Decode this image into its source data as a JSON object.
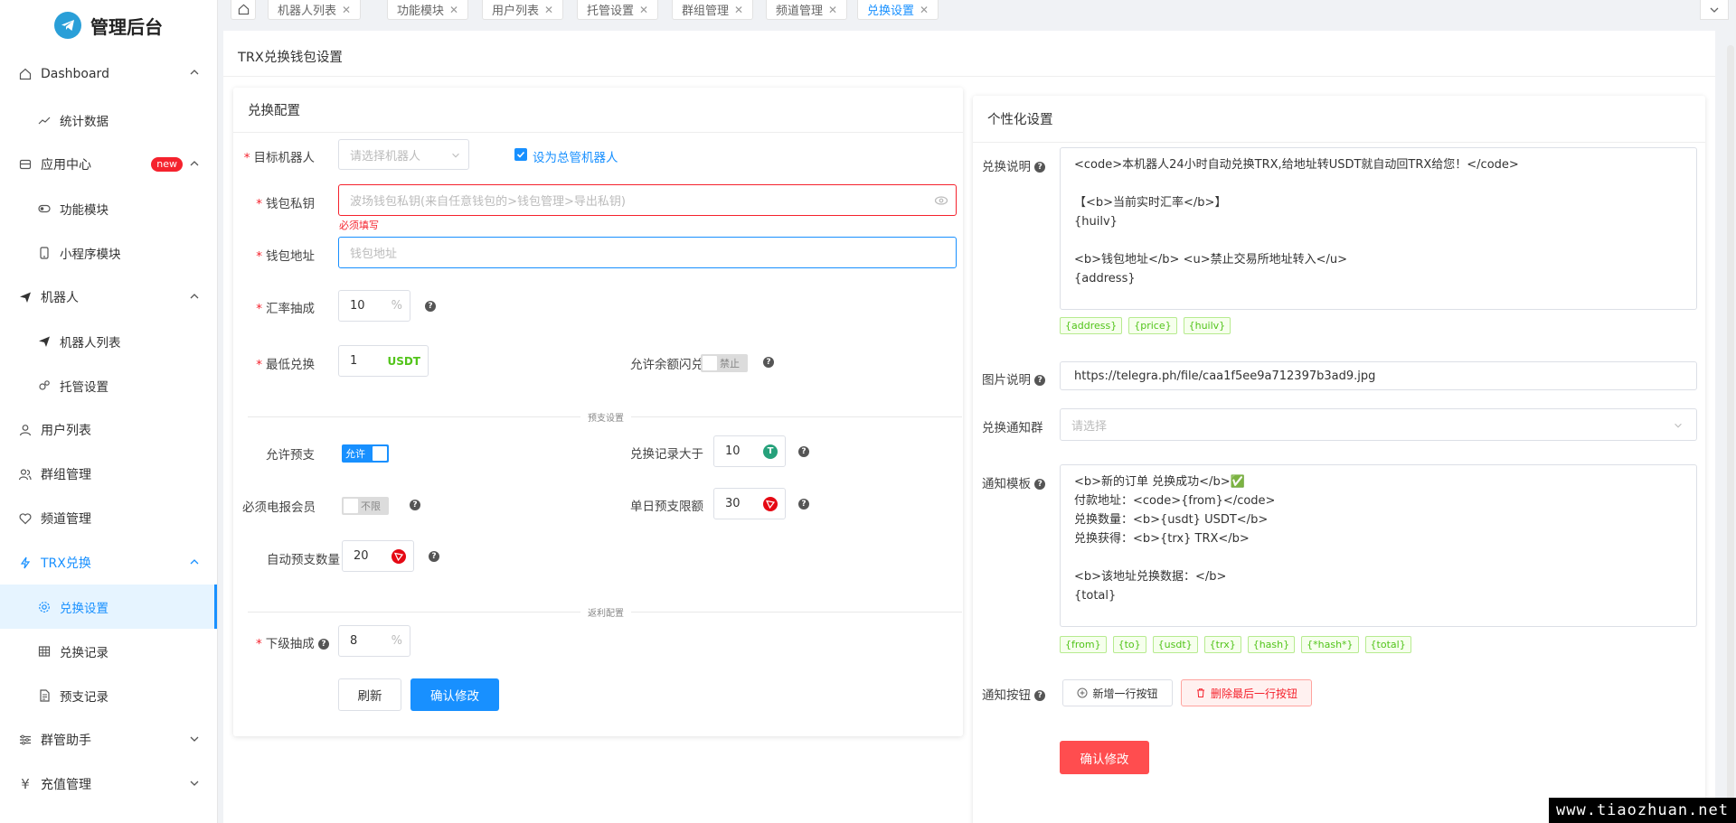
{
  "app": {
    "title": "管理后台"
  },
  "sidebar": {
    "items": [
      {
        "label": "Dashboard"
      },
      {
        "label": "统计数据"
      },
      {
        "label": "应用中心",
        "badge": "new"
      },
      {
        "label": "功能模块"
      },
      {
        "label": "小程序模块"
      },
      {
        "label": "机器人"
      },
      {
        "label": "机器人列表"
      },
      {
        "label": "托管设置"
      },
      {
        "label": "用户列表"
      },
      {
        "label": "群组管理"
      },
      {
        "label": "频道管理"
      },
      {
        "label": "TRX兑换"
      },
      {
        "label": "兑换设置"
      },
      {
        "label": "兑换记录"
      },
      {
        "label": "预支记录"
      },
      {
        "label": "群管助手"
      },
      {
        "label": "充值管理"
      }
    ]
  },
  "tabs": [
    {
      "label": "机器人列表"
    },
    {
      "label": "功能模块"
    },
    {
      "label": "用户列表"
    },
    {
      "label": "托管设置"
    },
    {
      "label": "群组管理"
    },
    {
      "label": "频道管理"
    },
    {
      "label": "兑换设置"
    }
  ],
  "page": {
    "title": "TRX兑换钱包设置"
  },
  "exchange": {
    "title": "兑换配置",
    "target_bot_label": "目标机器人",
    "target_bot_placeholder": "请选择机器人",
    "master_bot_label": "设为总管机器人",
    "private_key_label": "钱包私钥",
    "private_key_placeholder": "波场钱包私钥(来自任意钱包的>钱包管理>导出私钥)",
    "private_key_error": "必须填写",
    "address_label": "钱包地址",
    "address_placeholder": "钱包地址",
    "rate_label": "汇率抽成",
    "rate_value": "10",
    "rate_suffix": "%",
    "min_label": "最低兑换",
    "min_value": "1",
    "min_suffix": "USDT",
    "flash_label": "允许余额闪兑",
    "flash_switch": "禁止",
    "advance_divider": "预支设置",
    "allow_advance_label": "允许预支",
    "allow_advance_switch": "允许",
    "records_gt_label": "兑换记录大于",
    "records_gt_value": "10",
    "premium_label": "必须电报会员",
    "premium_switch": "不限",
    "daily_limit_label": "单日预支限额",
    "daily_limit_value": "30",
    "auto_advance_label": "自动预支数量",
    "auto_advance_value": "20",
    "rebate_divider": "返利配置",
    "sub_rate_label": "下级抽成",
    "sub_rate_value": "8",
    "sub_rate_suffix": "%",
    "refresh_button": "刷新",
    "confirm_button": "确认修改"
  },
  "personal": {
    "title": "个性化设置",
    "desc_label": "兑换说明",
    "desc_value": "<code>本机器人24小时自动兑换TRX,给地址转USDT就自动回TRX给您！</code>\n\n【<b>当前实时汇率</b>】\n{huilv}\n\n<b>钱包地址</b> <u>禁止交易所地址转入</u>\n{address}",
    "desc_tags": [
      "{address}",
      "{price}",
      "{huilv}"
    ],
    "image_label": "图片说明",
    "image_value": "https://telegra.ph/file/caa1f5ee9a712397b3ad9.jpg",
    "group_label": "兑换通知群",
    "group_placeholder": "请选择",
    "template_label": "通知模板",
    "template_value": "<b>新的订单 兑换成功</b>✅\n付款地址：<code>{from}</code>\n兑换数量：<b>{usdt} USDT</b>\n兑换获得：<b>{trx} TRX</b>\n\n<b>该地址兑换数据：</b>\n{total}",
    "template_tags": [
      "{from}",
      "{to}",
      "{usdt}",
      "{trx}",
      "{hash}",
      "{*hash*}",
      "{total}"
    ],
    "buttons_label": "通知按钮",
    "add_row_button": "新增一行按钮",
    "delete_row_button": "删除最后一行按钮",
    "confirm_button": "确认修改"
  },
  "watermark": "www.tiaozhuan.net",
  "colors": {
    "primary": "#1890ff",
    "danger": "#f5222d",
    "tag": "#52c41a",
    "confirm_red": "#ff4d4f"
  }
}
